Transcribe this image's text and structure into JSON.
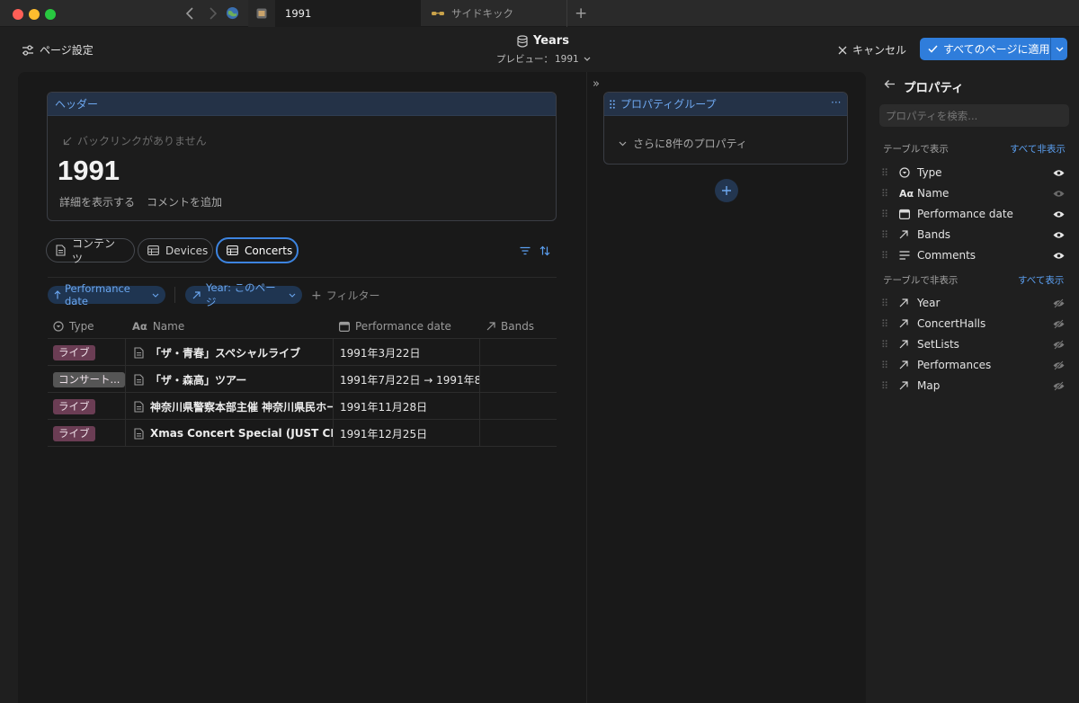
{
  "titlebar": {
    "tabs": [
      {
        "label": "1991"
      },
      {
        "label": "サイドキック"
      }
    ],
    "new_tab": "+"
  },
  "toolbar": {
    "page_settings": "ページ設定",
    "db_title": "Years",
    "preview_label": "プレビュー：",
    "preview_value": "1991",
    "cancel": "キャンセル",
    "apply": "すべてのページに適用"
  },
  "header_card": {
    "title": "ヘッダー",
    "backlinks": "バックリンクがありません",
    "page_title": "1991",
    "show_details": "詳細を表示する",
    "add_comment": "コメントを追加"
  },
  "view_tabs": [
    {
      "label": "コンテンツ",
      "icon": "doc-icon"
    },
    {
      "label": "Devices",
      "icon": "table-icon"
    },
    {
      "label": "Concerts",
      "icon": "table-icon",
      "active": true
    }
  ],
  "filters": {
    "sort_chip": "Performance date",
    "year_chip": "Year: このページ",
    "add_filter": "フィルター"
  },
  "table": {
    "columns": [
      "Type",
      "Name",
      "Performance date",
      "Bands"
    ],
    "rows": [
      {
        "type": "ライブ",
        "type_color": "#6b3d54",
        "name": "「ザ・青春」スペシャルライブ",
        "date": "1991年3月22日"
      },
      {
        "type": "コンサート...",
        "type_color": "#555555",
        "name": "「ザ・森高」ツアー",
        "date": "1991年7月22日 → 1991年8月"
      },
      {
        "type": "ライブ",
        "type_color": "#6b3d54",
        "name": "神奈川県警察本部主催 神奈川県民ホール",
        "date": "1991年11月28日"
      },
      {
        "type": "ライブ",
        "type_color": "#6b3d54",
        "name": "Xmas Concert Special (JUST CHRISTMAS)",
        "date": "1991年12月25日"
      }
    ]
  },
  "property_group": {
    "title": "プロパティグループ",
    "more": "さらに8件のプロパティ"
  },
  "sidebar": {
    "title": "プロパティ",
    "search_placeholder": "プロパティを検索...",
    "shown_header": "テーブルで表示",
    "hide_all": "すべて非表示",
    "shown": [
      {
        "label": "Type",
        "icon": "status-icon"
      },
      {
        "label": "Name",
        "icon": "text-icon"
      },
      {
        "label": "Performance date",
        "icon": "calendar-icon"
      },
      {
        "label": "Bands",
        "icon": "relation-arrow-icon"
      },
      {
        "label": "Comments",
        "icon": "lines-icon"
      }
    ],
    "hidden_header": "テーブルで非表示",
    "show_all": "すべて表示",
    "hidden": [
      {
        "label": "Year",
        "icon": "relation-arrow-icon"
      },
      {
        "label": "ConcertHalls",
        "icon": "relation-arrow-icon"
      },
      {
        "label": "SetLists",
        "icon": "relation-arrow-icon"
      },
      {
        "label": "Performances",
        "icon": "relation-arrow-icon"
      },
      {
        "label": "Map",
        "icon": "relation-arrow-icon"
      }
    ]
  },
  "colors": {
    "accent": "#2f7ddb",
    "link": "#5b9ff0",
    "tag_live": "#6b3d54",
    "tag_concert": "#555555"
  }
}
